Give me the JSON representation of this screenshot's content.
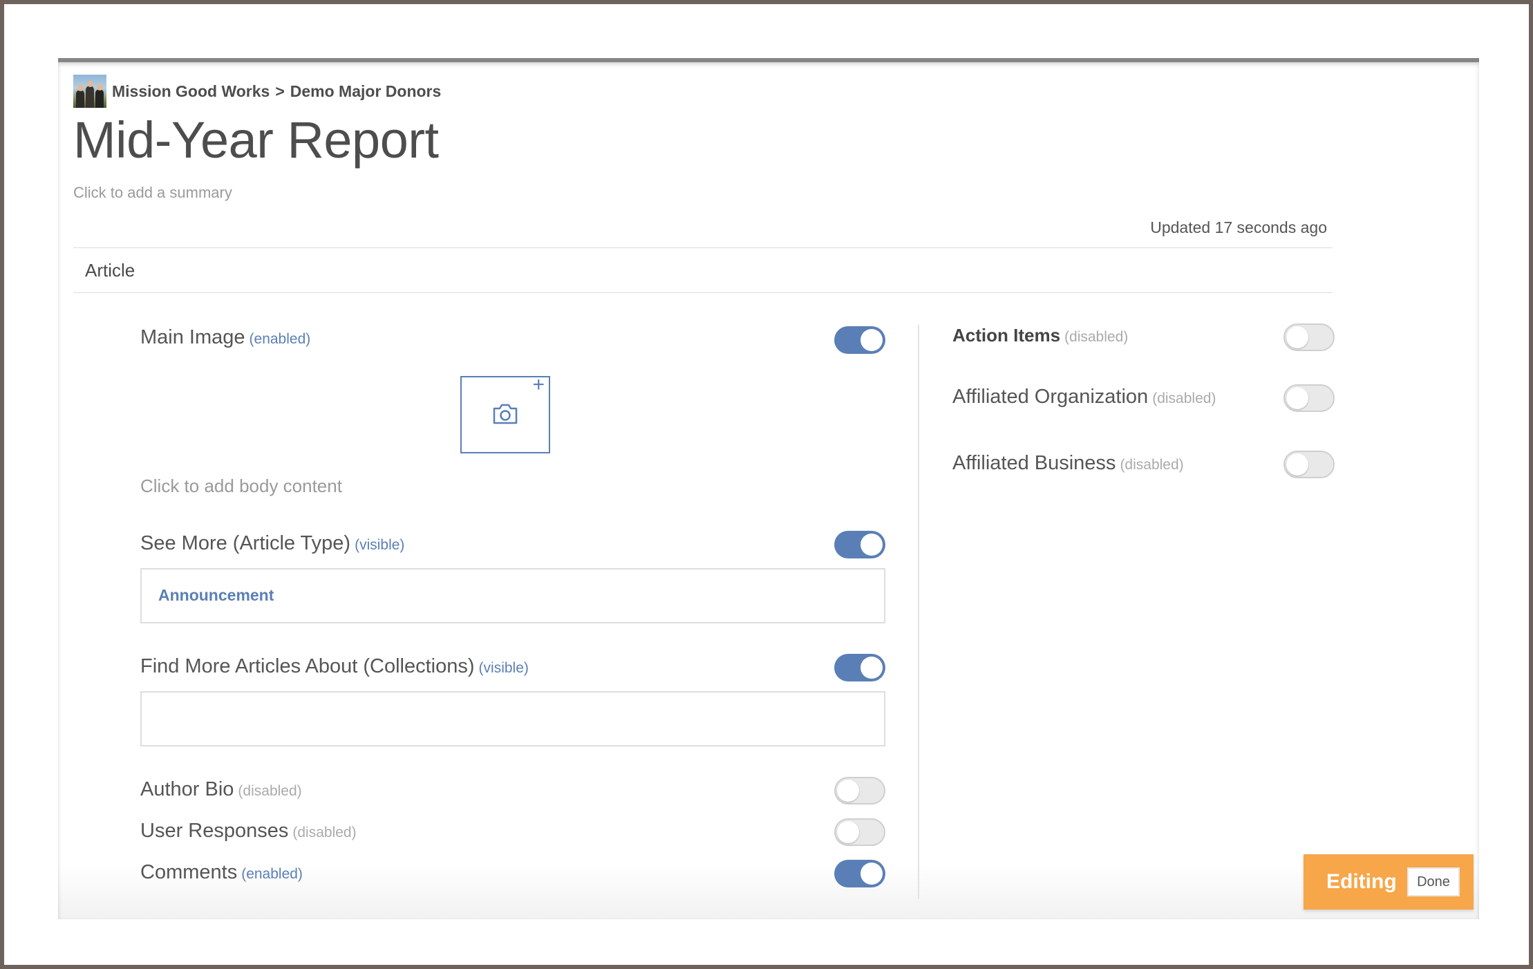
{
  "breadcrumb": {
    "organization": "Mission Good Works",
    "separator": ">",
    "section": "Demo Major Donors"
  },
  "page": {
    "title": "Mid-Year Report",
    "summary_placeholder": "Click to add a summary",
    "updated": "Updated 17 seconds ago",
    "tab": "Article"
  },
  "left": {
    "main_image": {
      "label": "Main Image",
      "state": "(enabled)",
      "on": true
    },
    "body_placeholder": "Click to add body content",
    "see_more": {
      "label": "See More (Article Type)",
      "state": "(visible)",
      "on": true,
      "value": "Announcement"
    },
    "find_more": {
      "label": "Find More Articles About (Collections)",
      "state": "(visible)",
      "on": true,
      "value": ""
    },
    "author_bio": {
      "label": "Author Bio",
      "state": "(disabled)",
      "on": false
    },
    "user_responses": {
      "label": "User Responses",
      "state": "(disabled)",
      "on": false
    },
    "comments": {
      "label": "Comments",
      "state": "(enabled)",
      "on": true
    }
  },
  "right": {
    "action_items": {
      "label": "Action Items",
      "state": "(disabled)",
      "on": false
    },
    "affiliated_org": {
      "label": "Affiliated Organization",
      "state": "(disabled)",
      "on": false
    },
    "affiliated_business": {
      "label": "Affiliated Business",
      "state": "(disabled)",
      "on": false
    }
  },
  "editing": {
    "label": "Editing",
    "done": "Done"
  },
  "colors": {
    "accent": "#5a7fb6",
    "editing": "#f7a64a",
    "toggle_off": "#e9e9e9"
  }
}
